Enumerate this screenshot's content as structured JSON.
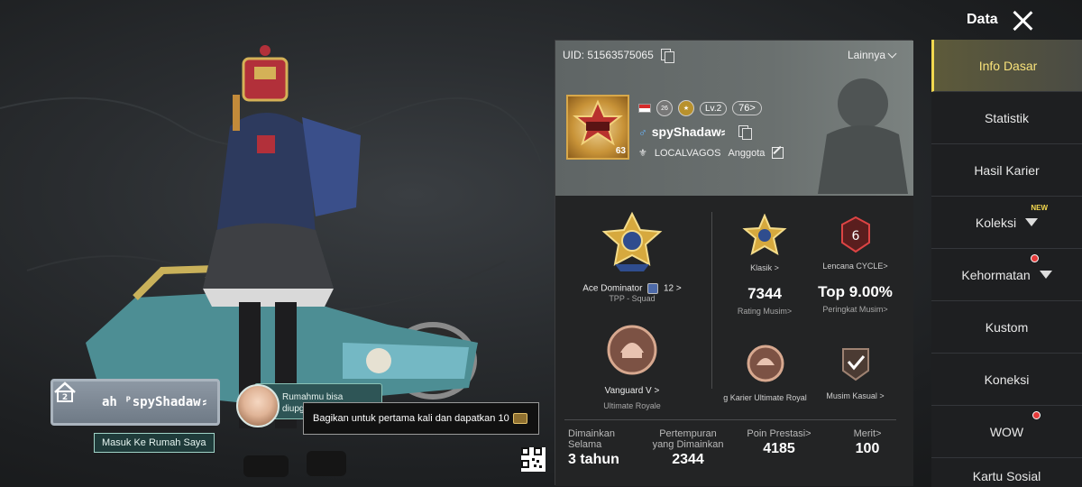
{
  "colors": {
    "accent_gold": "#f1d84f",
    "panel_bg": "#2a2b2c",
    "profile_bg": "#6a706f",
    "teal": "#2e5556"
  },
  "scene": {
    "plaque": {
      "level": "2",
      "name": "ah  ᴾspyShadaw⸗",
      "enter_label": "Masuk Ke Rumah Saya",
      "icon": "house-icon"
    },
    "bubble": {
      "text": "Rumahmu bisa diupgrade"
    },
    "share": {
      "text": "Bagikan untuk pertama kali dan dapatkan 10",
      "icon": "coupon-icon"
    },
    "qr": {
      "icon": "qr-code-icon"
    }
  },
  "panel": {
    "uid": "UID: 51563575065",
    "more_label": "Lainnya",
    "avatar_level": "63",
    "level": "Lv.2",
    "badge_small": "26",
    "popularity": "76>",
    "name": "spyShadaw⸗",
    "clan": "LOCALVAGOS",
    "clan_role": "Anggota",
    "rank_tpp": {
      "title": "Ace Dominator",
      "stars": "12",
      "mode": "TPP - Squad"
    },
    "rank_ultimate": {
      "title": "Vanguard V >",
      "mode": "Ultimate Royale"
    },
    "classic": {
      "label": "Klasik >",
      "rating": "7344",
      "rating_label": "Rating Musim>"
    },
    "cycle": {
      "label": "Lencana CYCLE>",
      "top": "Top 9.00%",
      "top_label": "Peringkat Musim>"
    },
    "career_ultimate": {
      "label": "g Karier Ultimate Royal"
    },
    "casual": {
      "label": "Musim Kasual >"
    },
    "bottom": [
      {
        "title": "Dimainkan Selama",
        "value": "3 tahun"
      },
      {
        "title": "Pertempuran yang Dimainkan",
        "value": "2344"
      },
      {
        "title": "Poin Prestasi>",
        "value": "4185"
      },
      {
        "title": "Merit>",
        "value": "100"
      }
    ]
  },
  "menu": {
    "title": "Data",
    "items": [
      {
        "label": "Info Dasar"
      },
      {
        "label": "Statistik"
      },
      {
        "label": "Hasil Karier"
      },
      {
        "label": "Koleksi",
        "badge": "NEW"
      },
      {
        "label": "Kehormatan"
      },
      {
        "label": "Kustom"
      },
      {
        "label": "Koneksi"
      },
      {
        "label": "WOW"
      },
      {
        "label": "Kartu Sosial"
      }
    ]
  }
}
